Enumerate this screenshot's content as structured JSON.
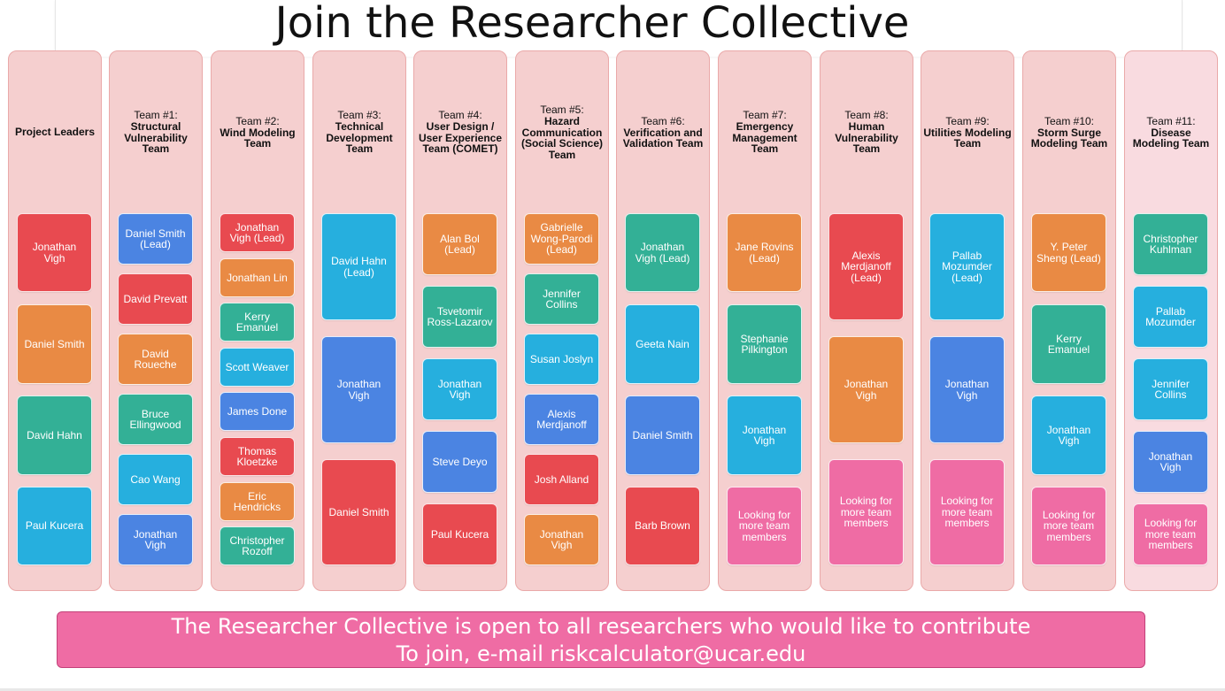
{
  "title": "Join the Researcher Collective",
  "columns": [
    {
      "team_no": "",
      "name": "Project Leaders",
      "members": [
        {
          "text": "Jonathan Vigh",
          "color": "red"
        },
        {
          "text": "Daniel Smith",
          "color": "orange"
        },
        {
          "text": "David Hahn",
          "color": "teal"
        },
        {
          "text": "Paul Kucera",
          "color": "cyan"
        }
      ]
    },
    {
      "team_no": "Team #1:",
      "name": "Structural Vulnerability Team",
      "members": [
        {
          "text": "Daniel Smith (Lead)",
          "color": "blue"
        },
        {
          "text": "David Prevatt",
          "color": "red"
        },
        {
          "text": "David Roueche",
          "color": "orange"
        },
        {
          "text": "Bruce Ellingwood",
          "color": "teal"
        },
        {
          "text": "Cao Wang",
          "color": "cyan"
        },
        {
          "text": "Jonathan Vigh",
          "color": "blue"
        }
      ]
    },
    {
      "team_no": "Team #2:",
      "name": "Wind Modeling Team",
      "members": [
        {
          "text": "Jonathan Vigh (Lead)",
          "color": "red"
        },
        {
          "text": "Jonathan Lin",
          "color": "orange"
        },
        {
          "text": "Kerry Emanuel",
          "color": "teal"
        },
        {
          "text": "Scott Weaver",
          "color": "cyan"
        },
        {
          "text": "James Done",
          "color": "blue"
        },
        {
          "text": "Thomas Kloetzke",
          "color": "red"
        },
        {
          "text": "Eric Hendricks",
          "color": "orange"
        },
        {
          "text": "Christopher Rozoff",
          "color": "teal"
        }
      ]
    },
    {
      "team_no": "Team #3:",
      "name": "Technical Development Team",
      "members": [
        {
          "text": "David Hahn (Lead)",
          "color": "cyan"
        },
        {
          "text": "Jonathan Vigh",
          "color": "blue"
        },
        {
          "text": "Daniel Smith",
          "color": "red"
        }
      ]
    },
    {
      "team_no": "Team #4:",
      "name": "User Design / User Experience Team (COMET)",
      "members": [
        {
          "text": "Alan Bol (Lead)",
          "color": "orange"
        },
        {
          "text": "Tsvetomir Ross-Lazarov",
          "color": "teal"
        },
        {
          "text": "Jonathan Vigh",
          "color": "cyan"
        },
        {
          "text": "Steve Deyo",
          "color": "blue"
        },
        {
          "text": "Paul Kucera",
          "color": "red"
        }
      ]
    },
    {
      "team_no": "Team #5:",
      "name": "Hazard Communication (Social Science) Team",
      "members": [
        {
          "text": "Gabrielle Wong-Parodi (Lead)",
          "color": "orange"
        },
        {
          "text": "Jennifer Collins",
          "color": "teal"
        },
        {
          "text": "Susan Joslyn",
          "color": "cyan"
        },
        {
          "text": "Alexis Merdjanoff",
          "color": "blue"
        },
        {
          "text": "Josh Alland",
          "color": "red"
        },
        {
          "text": "Jonathan Vigh",
          "color": "orange"
        }
      ]
    },
    {
      "team_no": "Team #6:",
      "name": "Verification and Validation Team",
      "members": [
        {
          "text": "Jonathan Vigh (Lead)",
          "color": "teal"
        },
        {
          "text": "Geeta Nain",
          "color": "cyan"
        },
        {
          "text": "Daniel Smith",
          "color": "blue"
        },
        {
          "text": "Barb Brown",
          "color": "red"
        }
      ]
    },
    {
      "team_no": "Team #7:",
      "name": "Emergency Management Team",
      "members": [
        {
          "text": "Jane Rovins (Lead)",
          "color": "orange"
        },
        {
          "text": "Stephanie Pilkington",
          "color": "teal"
        },
        {
          "text": "Jonathan Vigh",
          "color": "cyan"
        },
        {
          "text": "Looking for more team members",
          "color": "pink"
        }
      ]
    },
    {
      "team_no": "Team #8:",
      "name": "Human Vulnerability Team",
      "members": [
        {
          "text": "Alexis Merdjanoff (Lead)",
          "color": "red"
        },
        {
          "text": "Jonathan Vigh",
          "color": "orange"
        },
        {
          "text": "Looking for more team members",
          "color": "pink"
        }
      ]
    },
    {
      "team_no": "Team #9:",
      "name": "Utilities Modeling Team",
      "members": [
        {
          "text": "Pallab Mozumder (Lead)",
          "color": "cyan"
        },
        {
          "text": "Jonathan Vigh",
          "color": "blue"
        },
        {
          "text": "Looking for more team members",
          "color": "pink"
        }
      ]
    },
    {
      "team_no": "Team #10:",
      "name": "Storm Surge Modeling Team",
      "members": [
        {
          "text": "Y. Peter Sheng (Lead)",
          "color": "orange"
        },
        {
          "text": "Kerry Emanuel",
          "color": "teal"
        },
        {
          "text": "Jonathan Vigh",
          "color": "cyan"
        },
        {
          "text": "Looking for more team members",
          "color": "pink"
        }
      ]
    },
    {
      "team_no": "Team #11:",
      "name": "Disease Modeling Team",
      "members": [
        {
          "text": "Christopher Kuhlman",
          "color": "teal"
        },
        {
          "text": "Pallab Mozumder",
          "color": "cyan"
        },
        {
          "text": "Jennifer Collins",
          "color": "cyan"
        },
        {
          "text": "Jonathan Vigh",
          "color": "blue"
        },
        {
          "text": "Looking for more team members",
          "color": "pink"
        }
      ]
    }
  ],
  "banner": {
    "line1": "The Researcher Collective is open to all researchers who would like to contribute",
    "line2": "To join, e-mail riskcalculator@ucar.edu"
  }
}
